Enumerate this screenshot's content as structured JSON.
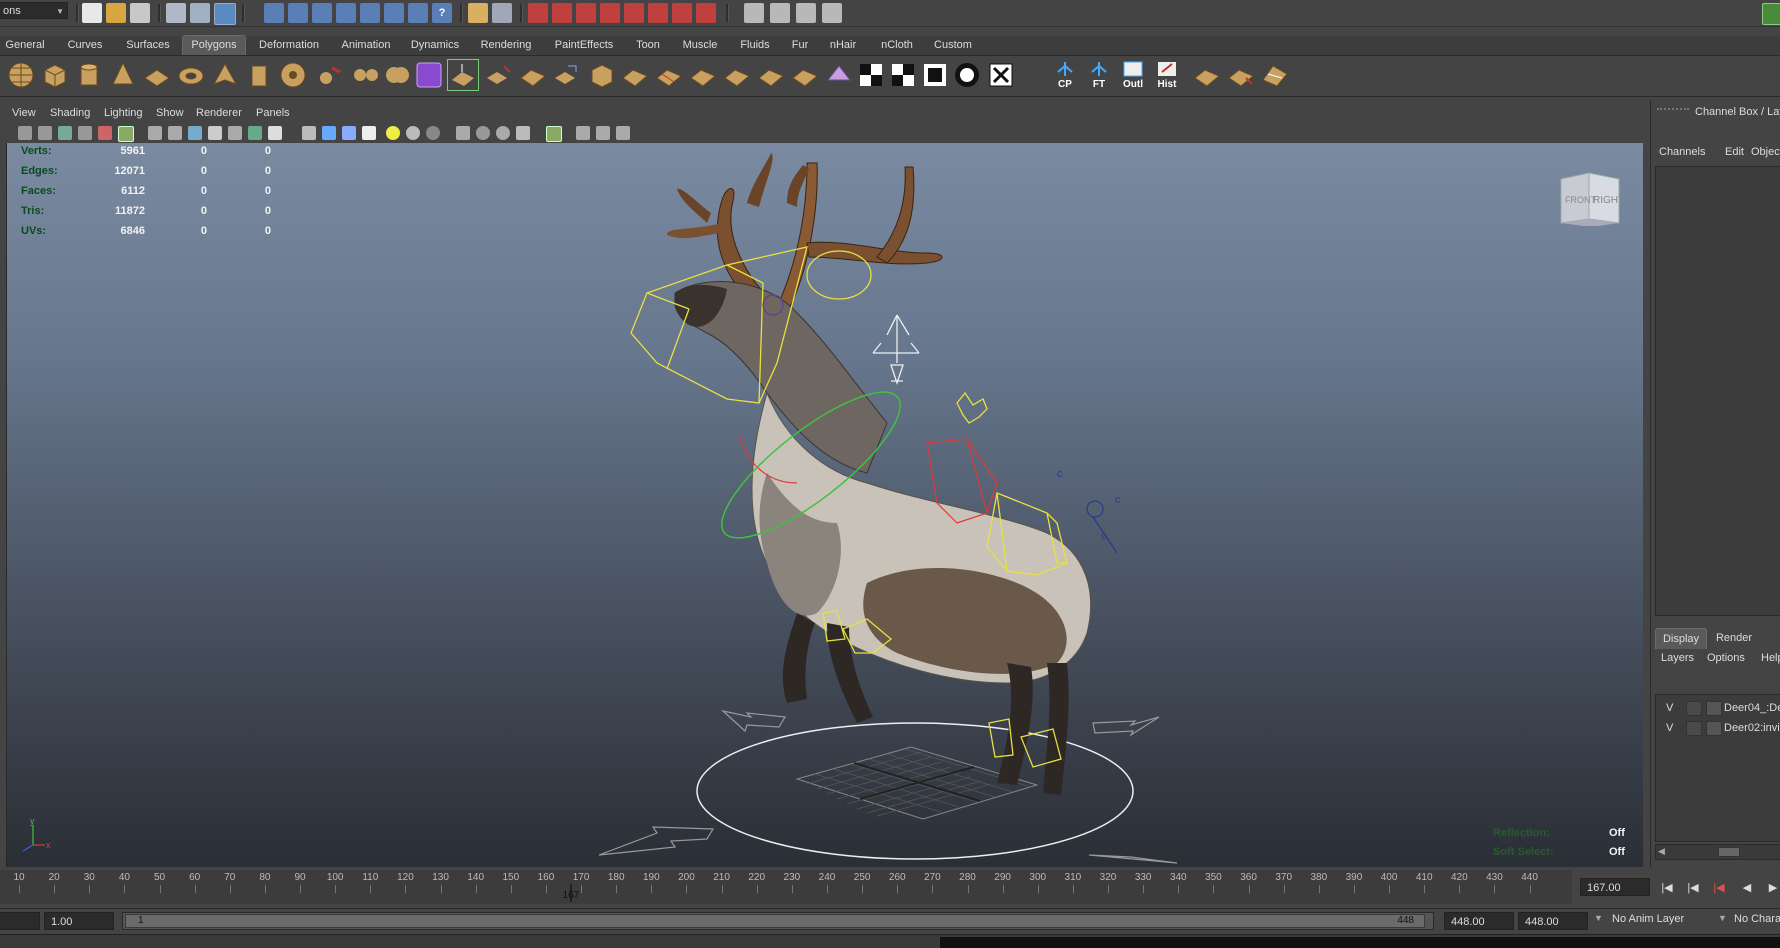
{
  "topbar": {
    "mode_select": "ons",
    "icons": [
      "new-scene-icon",
      "open-scene-icon",
      "save-scene-icon",
      "select-by-hierarchy-icon",
      "select-by-object-icon",
      "select-by-component-icon",
      "lock-selection-icon",
      "snap-to-grid-icon",
      "snap-to-curve-icon",
      "snap-to-point-icon",
      "snap-to-view-plane-icon",
      "snap-to-live-icon",
      "make-live-icon",
      "history-icon",
      "help-icon",
      "input-output-icon",
      "construction-history-icon",
      "render-current-frame-icon",
      "ipr-render-icon",
      "render-settings-icon",
      "hypershade-icon",
      "render-view-icon",
      "show-attribute-editor-icon",
      "show-tool-settings-icon",
      "show-channel-box-icon",
      "show-modeling-toolkit-icon"
    ]
  },
  "shelf_tabs": [
    "General",
    "Curves",
    "Surfaces",
    "Polygons",
    "Deformation",
    "Animation",
    "Dynamics",
    "Rendering",
    "PaintEffects",
    "Toon",
    "Muscle",
    "Fluids",
    "Fur",
    "nHair",
    "nCloth",
    "Custom"
  ],
  "shelf_active_tab": "Polygons",
  "shelf_text_icons": [
    "CP",
    "FT",
    "Outl",
    "Hist"
  ],
  "panel_menu": [
    "View",
    "Shading",
    "Lighting",
    "Show",
    "Renderer",
    "Panels"
  ],
  "hud": [
    {
      "label": "Verts:",
      "v1": "5961",
      "v2": "0",
      "v3": "0"
    },
    {
      "label": "Edges:",
      "v1": "12071",
      "v2": "0",
      "v3": "0"
    },
    {
      "label": "Faces:",
      "v1": "6112",
      "v2": "0",
      "v3": "0"
    },
    {
      "label": "Tris:",
      "v1": "11872",
      "v2": "0",
      "v3": "0"
    },
    {
      "label": "UVs:",
      "v1": "6846",
      "v2": "0",
      "v3": "0"
    }
  ],
  "viewcube": {
    "front": "FRONT",
    "right": "RIGHT"
  },
  "hud_bottom": [
    {
      "label": "Reflection:",
      "value": "Off"
    },
    {
      "label": "Soft Select:",
      "value": "Off"
    }
  ],
  "axis": {
    "y": "y",
    "x": "x"
  },
  "channel_box": {
    "title": "Channel Box / Layer",
    "menus": [
      "Channels",
      "Edit",
      "Object"
    ],
    "layer_tabs": [
      "Display",
      "Render"
    ],
    "layer_menus": [
      "Layers",
      "Options",
      "Help"
    ],
    "layers": [
      {
        "v": "V",
        "name": "Deer04_:De"
      },
      {
        "v": "V",
        "name": "Deer02:invi"
      }
    ]
  },
  "timeline": {
    "ticks": [
      "10",
      "20",
      "30",
      "40",
      "50",
      "60",
      "70",
      "80",
      "90",
      "100",
      "110",
      "120",
      "130",
      "140",
      "150",
      "160",
      "170",
      "180",
      "190",
      "200",
      "210",
      "220",
      "230",
      "240",
      "250",
      "260",
      "270",
      "280",
      "290",
      "300",
      "310",
      "320",
      "330",
      "340",
      "350",
      "360",
      "370",
      "380",
      "390",
      "400",
      "410",
      "420",
      "430",
      "440"
    ],
    "current_frame_label": "167",
    "current_frame": 167,
    "current_time_field": "167.00",
    "playback_buttons": [
      "go-to-start-icon",
      "step-back-key-icon",
      "step-back-frame-icon",
      "play-backwards-icon",
      "play-forwards-icon"
    ]
  },
  "range": {
    "start_field": "1.00",
    "range_start": "1",
    "range_end": "448",
    "end_field": "448.00",
    "end_field2": "448.00",
    "anim_layer": "No Anim Layer",
    "character": "No Chara"
  }
}
